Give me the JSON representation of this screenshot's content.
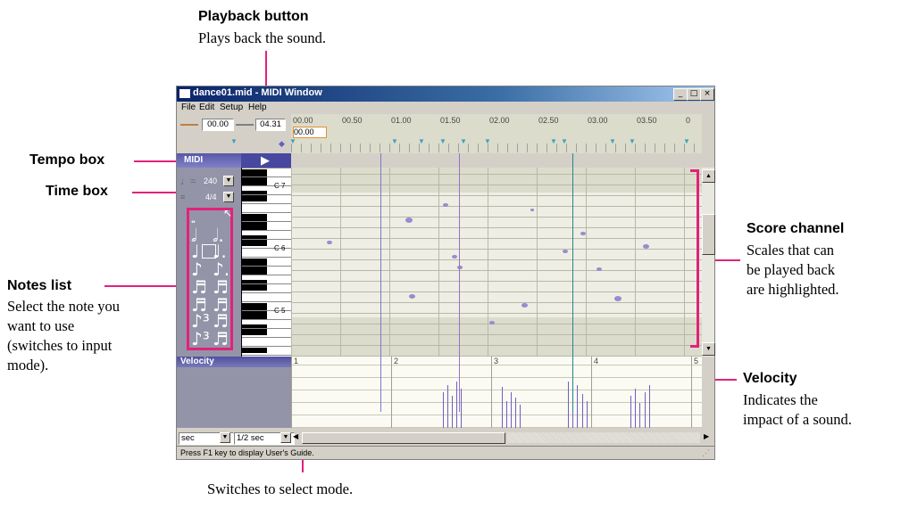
{
  "window": {
    "title": "dance01.mid - MIDI Window",
    "menu": [
      "File",
      "Edit",
      "Setup",
      "Help"
    ],
    "start_time": "00.00",
    "end_time": "04.31",
    "cursor_time": "00.00",
    "ruler": [
      "00.00",
      "00.50",
      "01.00",
      "01.50",
      "02.00",
      "02.50",
      "03.00",
      "03.50",
      "0"
    ],
    "panel_label": "MIDI",
    "tempo_value": "240",
    "time_signature": "4/4",
    "octave_labels": [
      "C 7",
      "C 6",
      "C 5"
    ],
    "velocity_label": "Velocity",
    "measures": [
      "1",
      "2",
      "3",
      "4",
      "5"
    ],
    "unit_select": "sec",
    "grid_select": "1/2 sec",
    "status": "Press F1 key to display User's Guide."
  },
  "annotations": {
    "playback": {
      "title": "Playback button",
      "body": "Plays back the sound."
    },
    "tempo": {
      "title": "Tempo box"
    },
    "time": {
      "title": "Time box"
    },
    "notes": {
      "title": "Notes list",
      "body": "Select the note you\nwant to use\n(switches to input\nmode)."
    },
    "score": {
      "title": "Score channel",
      "body": "Scales that can\nbe played back\nare highlighted."
    },
    "velocity": {
      "title": "Velocity",
      "body": "Indicates the\nimpact of a sound."
    },
    "select_mode": {
      "body": "Switches to select mode."
    }
  },
  "colors": {
    "annotation_line": "#e2227a",
    "title_bar": "#0a246a",
    "note_dot": "#9a8ad0",
    "velocity_bar": "#7060c0"
  }
}
